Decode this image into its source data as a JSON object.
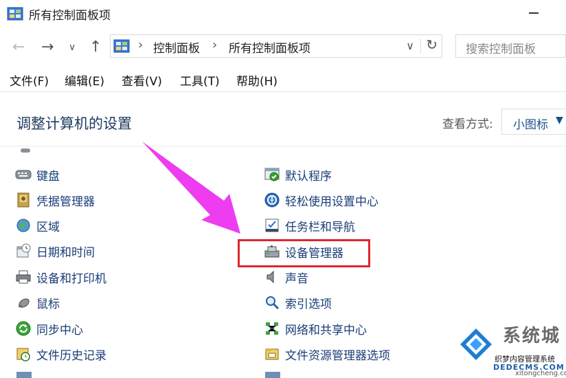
{
  "window": {
    "title": "所有控制面板项"
  },
  "nav": {
    "address_parts": [
      "控制面板",
      "所有控制面板项"
    ],
    "search_placeholder": "搜索控制面板"
  },
  "menu": {
    "items": [
      "文件(F)",
      "编辑(E)",
      "查看(V)",
      "工具(T)",
      "帮助(H)"
    ]
  },
  "content": {
    "heading": "调整计算机的设置",
    "view_by_label": "查看方式:",
    "view_by_value": "小图标",
    "left_items": [
      {
        "label": "键盘",
        "icon": "keyboard-icon"
      },
      {
        "label": "凭据管理器",
        "icon": "credential-manager-icon"
      },
      {
        "label": "区域",
        "icon": "region-icon"
      },
      {
        "label": "日期和时间",
        "icon": "date-time-icon"
      },
      {
        "label": "设备和打印机",
        "icon": "printer-icon"
      },
      {
        "label": "鼠标",
        "icon": "mouse-icon"
      },
      {
        "label": "同步中心",
        "icon": "sync-center-icon"
      },
      {
        "label": "文件历史记录",
        "icon": "file-history-icon"
      }
    ],
    "right_items": [
      {
        "label": "默认程序",
        "icon": "default-programs-icon"
      },
      {
        "label": "轻松使用设置中心",
        "icon": "ease-of-access-icon"
      },
      {
        "label": "任务栏和导航",
        "icon": "taskbar-icon"
      },
      {
        "label": "设备管理器",
        "icon": "device-manager-icon"
      },
      {
        "label": "声音",
        "icon": "sound-icon"
      },
      {
        "label": "索引选项",
        "icon": "indexing-icon"
      },
      {
        "label": "网络和共享中心",
        "icon": "network-sharing-icon"
      },
      {
        "label": "文件资源管理器选项",
        "icon": "file-explorer-options-icon"
      }
    ],
    "highlighted_item": "设备管理器"
  },
  "watermark": {
    "brand": "系统城",
    "tagline": "织梦内容管理系统",
    "domain": "DEDECMS.COM",
    "url": "xitongcheng.com"
  },
  "colors": {
    "link": "#1a3d78",
    "heading": "#1e3a5f",
    "highlight_box": "#e0252f",
    "annotation_arrow": "#ee3cf0"
  }
}
